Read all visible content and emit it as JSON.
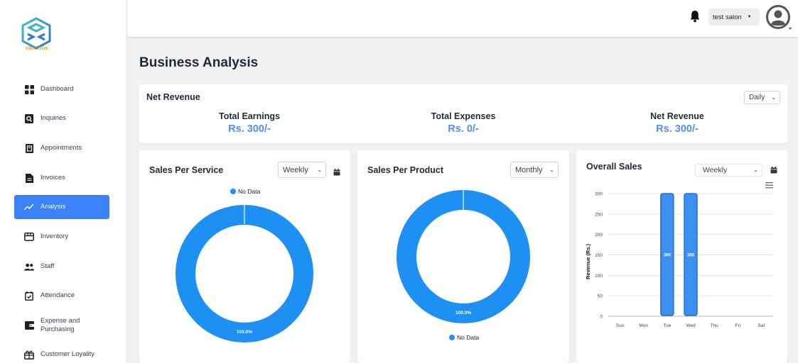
{
  "brand": {
    "name": "SWALOOK"
  },
  "sidebar": {
    "items": [
      {
        "label": "Dashboard",
        "icon": "dashboard-icon"
      },
      {
        "label": "Inquiries",
        "icon": "inquiries-icon"
      },
      {
        "label": "Appointments",
        "icon": "appointments-icon"
      },
      {
        "label": "Invoices",
        "icon": "invoices-icon"
      },
      {
        "label": "Analysis",
        "icon": "analysis-icon",
        "active": true
      },
      {
        "label": "Inventory",
        "icon": "inventory-icon"
      },
      {
        "label": "Staff",
        "icon": "staff-icon"
      },
      {
        "label": "Attendance",
        "icon": "attendance-icon"
      },
      {
        "label": "Expense and Purchasing",
        "icon": "wallet-icon"
      },
      {
        "label": "Customer Loyality",
        "icon": "gift-icon"
      }
    ]
  },
  "header": {
    "user_label": "test salon"
  },
  "page": {
    "title": "Business Analysis"
  },
  "net_revenue_card": {
    "title": "Net Revenue",
    "period": "Daily",
    "stats": [
      {
        "label": "Total Earnings",
        "value": "Rs. 300/-"
      },
      {
        "label": "Total Expenses",
        "value": "Rs. 0/-"
      },
      {
        "label": "Net Revenue",
        "value": "Rs. 300/-"
      }
    ]
  },
  "sales_per_service": {
    "title": "Sales Per Service",
    "period": "Weekly",
    "legend": "No Data",
    "slice_label": "100.0%"
  },
  "sales_per_product": {
    "title": "Sales Per Product",
    "period": "Monthly",
    "legend": "No Data",
    "slice_label": "100.0%"
  },
  "overall_sales": {
    "title": "Overall Sales",
    "period": "Weekly"
  },
  "colors": {
    "accent": "#3b82f6",
    "donut": "#1e8ff3",
    "value_text": "#4f8ff7"
  },
  "chart_data": [
    {
      "type": "pie",
      "title": "Sales Per Service",
      "categories": [
        "No Data"
      ],
      "values": [
        100
      ],
      "labels": [
        "100.0%"
      ],
      "legend": "top"
    },
    {
      "type": "pie",
      "title": "Sales Per Product",
      "categories": [
        "No Data"
      ],
      "values": [
        100
      ],
      "labels": [
        "100.0%"
      ],
      "legend": "bottom"
    },
    {
      "type": "bar",
      "title": "Overall Sales",
      "categories": [
        "Sun",
        "Mon",
        "Tue",
        "Wed",
        "Thu",
        "Fri",
        "Sat"
      ],
      "values": [
        0,
        0,
        300,
        300,
        0,
        0,
        0
      ],
      "data_labels": [
        "",
        "",
        "300",
        "300",
        "",
        "",
        ""
      ],
      "ylabel": "Revenue (Rs.)",
      "yticks": [
        "0",
        "50",
        "100",
        "150",
        "200",
        "250",
        "300"
      ],
      "ylim": [
        0,
        300
      ],
      "grid": true
    }
  ]
}
